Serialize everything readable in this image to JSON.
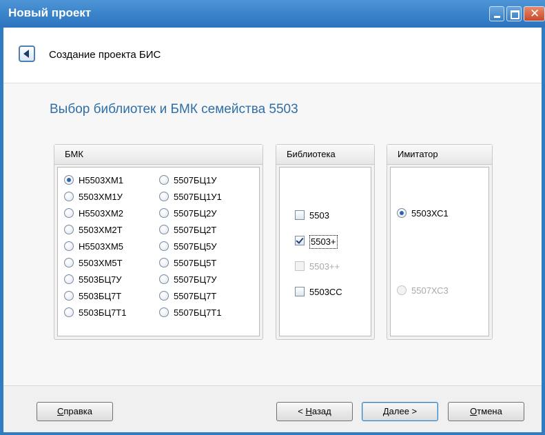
{
  "window": {
    "title": "Новый проект"
  },
  "header": {
    "title": "Создание проекта БИС"
  },
  "page_title": "Выбор библиотек и БМК семейства 5503",
  "bmk": {
    "label": "БМК",
    "col1": [
      {
        "label": "Н5503ХМ1",
        "selected": true
      },
      {
        "label": "5503ХМ1У",
        "selected": false
      },
      {
        "label": "Н5503ХМ2",
        "selected": false
      },
      {
        "label": "5503ХМ2Т",
        "selected": false
      },
      {
        "label": "Н5503ХМ5",
        "selected": false
      },
      {
        "label": "5503ХМ5Т",
        "selected": false
      },
      {
        "label": "5503БЦ7У",
        "selected": false
      },
      {
        "label": "5503БЦ7Т",
        "selected": false
      },
      {
        "label": "5503БЦ7Т1",
        "selected": false
      }
    ],
    "col2": [
      {
        "label": "5507БЦ1У",
        "selected": false
      },
      {
        "label": "5507БЦ1У1",
        "selected": false
      },
      {
        "label": "5507БЦ2У",
        "selected": false
      },
      {
        "label": "5507БЦ2Т",
        "selected": false
      },
      {
        "label": "5507БЦ5У",
        "selected": false
      },
      {
        "label": "5507БЦ5Т",
        "selected": false
      },
      {
        "label": "5507БЦ7У",
        "selected": false
      },
      {
        "label": "5507БЦ7Т",
        "selected": false
      },
      {
        "label": "5507БЦ7Т1",
        "selected": false
      }
    ]
  },
  "library": {
    "label": "Библиотека",
    "items": [
      {
        "label": "5503",
        "checked": false,
        "enabled": true
      },
      {
        "label": "5503+",
        "checked": true,
        "enabled": true
      },
      {
        "label": "5503++",
        "checked": false,
        "enabled": false
      },
      {
        "label": "5503СС",
        "checked": false,
        "enabled": true
      }
    ]
  },
  "simulator": {
    "label": "Имитатор",
    "items": [
      {
        "label": "5503ХС1",
        "selected": true,
        "enabled": true
      },
      {
        "label": "5507ХС3",
        "selected": false,
        "enabled": false
      }
    ]
  },
  "buttons": {
    "help_mn": "С",
    "help_rest": "правка",
    "back_pre": "< ",
    "back_mn": "Н",
    "back_rest": "азад",
    "next_mn": "Д",
    "next_rest": "алее >",
    "cancel_mn": "О",
    "cancel_rest": "тмена"
  }
}
